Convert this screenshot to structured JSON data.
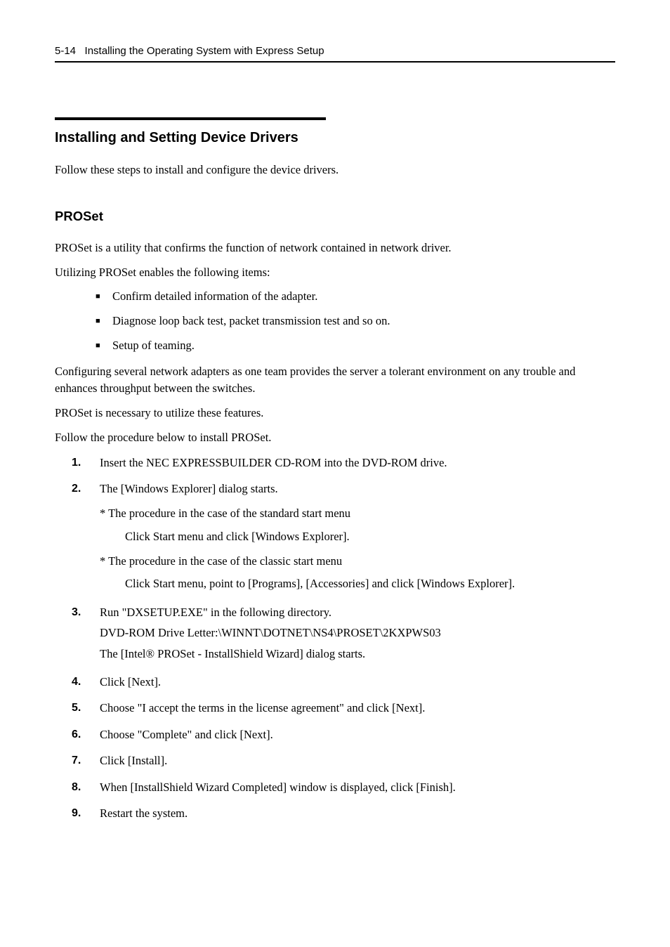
{
  "header": {
    "page": "5-14",
    "title": "Installing the Operating System with Express Setup"
  },
  "section": {
    "title": "Installing and Setting Device Drivers",
    "intro": "Follow these steps to install and configure the device drivers."
  },
  "proset": {
    "title": "PROSet",
    "p1": "PROSet is a utility that confirms the function of network contained in network driver.",
    "p2": "Utilizing PROSet enables the following items:",
    "bullets": [
      "Confirm detailed information of the adapter.",
      "Diagnose loop back test, packet transmission test and so on.",
      "Setup of teaming."
    ],
    "p3": "Configuring several network adapters as one team provides the server a tolerant environment on any trouble and enhances throughput between the switches.",
    "p4": "PROSet is necessary to utilize these features.",
    "p5": "Follow the procedure below to install PROSet.",
    "steps": {
      "s1": {
        "num": "1.",
        "text": "Insert the NEC EXPRESSBUILDER CD-ROM into the DVD-ROM drive."
      },
      "s2": {
        "num": "2.",
        "text": "The [Windows Explorer] dialog starts.",
        "star1": "* The procedure in the case of the standard start menu",
        "indent1": "Click Start menu and click [Windows Explorer].",
        "star2": "* The procedure in the case of the classic start menu",
        "indent2": "Click Start menu, point to [Programs], [Accessories] and click [Windows Explorer]."
      },
      "s3": {
        "num": "3.",
        "line1": "Run \"DXSETUP.EXE\" in the following directory.",
        "line2": "DVD-ROM Drive Letter:\\WINNT\\DOTNET\\NS4\\PROSET\\2KXPWS03",
        "line3": "The [Intel® PROSet - InstallShield Wizard] dialog starts."
      },
      "s4": {
        "num": "4.",
        "text": "Click [Next]."
      },
      "s5": {
        "num": "5.",
        "text": "Choose \"I accept the terms in the license agreement\" and click [Next]."
      },
      "s6": {
        "num": "6.",
        "text": "Choose \"Complete\" and click [Next]."
      },
      "s7": {
        "num": "7.",
        "text": "Click [Install]."
      },
      "s8": {
        "num": "8.",
        "text": "When [InstallShield Wizard Completed] window is displayed, click [Finish]."
      },
      "s9": {
        "num": "9.",
        "text": "Restart the system."
      }
    }
  }
}
